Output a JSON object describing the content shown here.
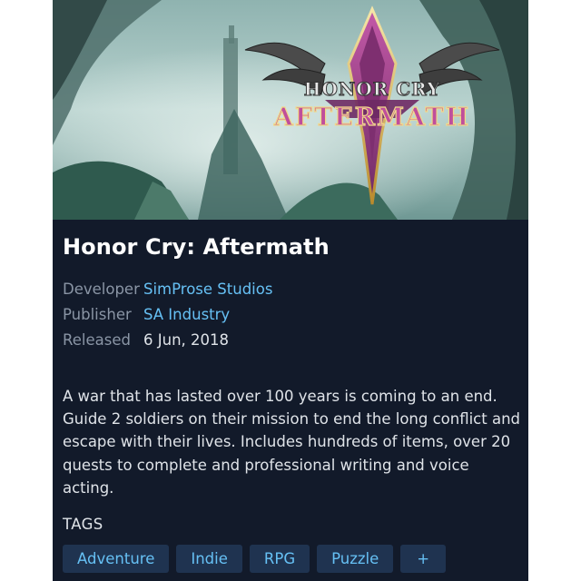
{
  "game": {
    "logo_top": "HONOR CRY",
    "logo_bottom": "AFTERMATH",
    "title": "Honor Cry: Aftermath",
    "details": {
      "developer_label": "Developer",
      "developer": "SimProse Studios",
      "publisher_label": "Publisher",
      "publisher": "SA Industry",
      "released_label": "Released",
      "released": "6 Jun, 2018"
    },
    "description": "A war that has lasted over 100 years is coming to an end. Guide 2 soldiers on their mission to end the long conflict and escape with their lives. Includes hundreds of items, over 20 quests to complete and professional writing and voice acting.",
    "tags_label": "TAGS",
    "tags": [
      "Adventure",
      "Indie",
      "RPG",
      "Puzzle"
    ],
    "more_tags": "+"
  },
  "colors": {
    "card_background": "#121a2a",
    "link": "#66c0f4",
    "tag_background": "#1f3350",
    "logo_emblem": "#9a3a86"
  }
}
